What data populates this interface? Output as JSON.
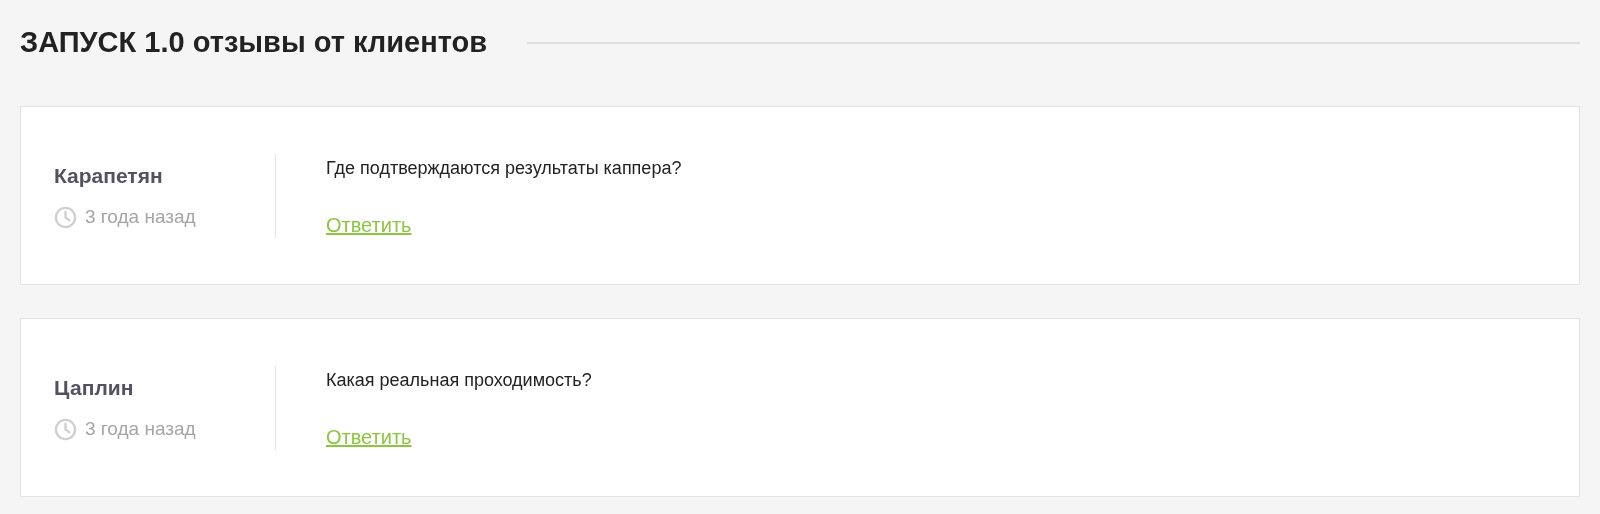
{
  "title": "ЗАПУСК 1.0 отзывы от клиентов",
  "reviews": [
    {
      "author": "Карапетян",
      "time": "3 года назад",
      "text": "Где подтверждаются результаты каппера?",
      "reply": "Ответить"
    },
    {
      "author": "Цаплин",
      "time": "3 года назад",
      "text": "Какая реальная проходимость?",
      "reply": "Ответить"
    }
  ]
}
